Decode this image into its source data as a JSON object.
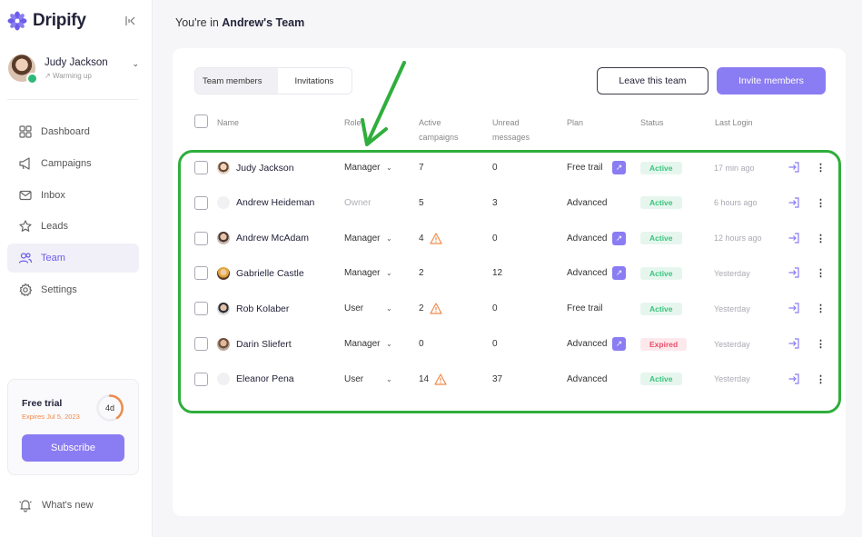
{
  "app": {
    "name": "Dripify",
    "brand_color": "#8a7cf2",
    "collapse_icon": "collapse-icon"
  },
  "user": {
    "name": "Judy Jackson",
    "status": "Warming up"
  },
  "nav": [
    {
      "label": "Dashboard",
      "icon": "dashboard-icon",
      "active": false
    },
    {
      "label": "Campaigns",
      "icon": "megaphone-icon",
      "active": false
    },
    {
      "label": "Inbox",
      "icon": "mail-icon",
      "active": false
    },
    {
      "label": "Leads",
      "icon": "star-icon",
      "active": false
    },
    {
      "label": "Team",
      "icon": "users-icon",
      "active": true
    },
    {
      "label": "Settings",
      "icon": "gear-icon",
      "active": false
    }
  ],
  "trial": {
    "title": "Free trial",
    "expires": "Expires Jul 5, 2023",
    "days_left": "4d",
    "subscribe_label": "Subscribe"
  },
  "whats_new": "What's new",
  "header": {
    "prefix": "You're in ",
    "team": "Andrew's Team"
  },
  "tabs": [
    {
      "label": "Team members",
      "active": true
    },
    {
      "label": "Invitations",
      "active": false
    }
  ],
  "actions": {
    "leave": "Leave this team",
    "invite": "Invite members"
  },
  "columns": {
    "name": "Name",
    "role": "Role",
    "campaigns_1": "Active",
    "campaigns_2": "campaigns",
    "unread_1": "Unread",
    "unread_2": "messages",
    "plan": "Plan",
    "status": "Status",
    "last_login": "Last Login"
  },
  "members": [
    {
      "name": "Judy Jackson",
      "role": "Manager",
      "role_editable": true,
      "campaigns": "7",
      "warning": false,
      "unread": "0",
      "plan": "Free trail",
      "upgrade": true,
      "status": "Active",
      "last_login": "17 min ago"
    },
    {
      "name": "Andrew Heideman",
      "role": "Owner",
      "role_editable": false,
      "campaigns": "5",
      "warning": false,
      "unread": "3",
      "plan": "Advanced",
      "upgrade": false,
      "status": "Active",
      "last_login": "6 hours ago"
    },
    {
      "name": "Andrew McAdam",
      "role": "Manager",
      "role_editable": true,
      "campaigns": "4",
      "warning": true,
      "unread": "0",
      "plan": "Advanced",
      "upgrade": true,
      "status": "Active",
      "last_login": "12 hours ago"
    },
    {
      "name": "Gabrielle Castle",
      "role": "Manager",
      "role_editable": true,
      "campaigns": "2",
      "warning": false,
      "unread": "12",
      "plan": "Advanced",
      "upgrade": true,
      "status": "Active",
      "last_login": "Yesterday"
    },
    {
      "name": "Rob Kolaber",
      "role": "User",
      "role_editable": true,
      "campaigns": "2",
      "warning": true,
      "unread": "0",
      "plan": "Free trail",
      "upgrade": false,
      "status": "Active",
      "last_login": "Yesterday"
    },
    {
      "name": "Darin Sliefert",
      "role": "Manager",
      "role_editable": true,
      "campaigns": "0",
      "warning": false,
      "unread": "0",
      "plan": "Advanced",
      "upgrade": true,
      "status": "Expired",
      "last_login": "Yesterday"
    },
    {
      "name": "Eleanor Pena",
      "role": "User",
      "role_editable": true,
      "campaigns": "14",
      "warning": true,
      "unread": "37",
      "plan": "Advanced",
      "upgrade": false,
      "status": "Active",
      "last_login": "Yesterday"
    }
  ],
  "annotation": {
    "highlight_color": "#2fae3c"
  }
}
